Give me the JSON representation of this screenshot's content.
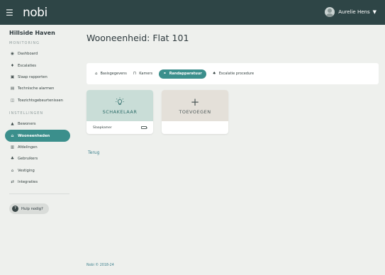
{
  "header": {
    "menu_icon": "hamburger-icon",
    "logo": "nobi",
    "user_name": "Aurelie Hens",
    "user_chevron": "chevron-down-icon"
  },
  "sidebar": {
    "org_name": "Hillside Haven",
    "monitoring_section": "MONITORING",
    "monitoring_items": [
      {
        "label": "Dashboard",
        "icon": "gauge-icon"
      },
      {
        "label": "Escalaties",
        "icon": "pin-icon"
      },
      {
        "label": "Slaap rapporten",
        "icon": "bed-icon"
      },
      {
        "label": "Technische alarmen",
        "icon": "server-icon"
      },
      {
        "label": "Toezichtsgebeurtenissen",
        "icon": "eye-icon"
      }
    ],
    "settings_section": "INSTELLINGEN",
    "settings_items": [
      {
        "label": "Bewoners",
        "icon": "people-icon"
      },
      {
        "label": "Wooneenheden",
        "icon": "house-icon",
        "active": true
      },
      {
        "label": "Afdelingen",
        "icon": "building-icon"
      },
      {
        "label": "Gebruikers",
        "icon": "users-icon"
      },
      {
        "label": "Vestiging",
        "icon": "home-icon"
      },
      {
        "label": "Integraties",
        "icon": "sync-icon"
      }
    ],
    "help_label": "Hulp nodig?"
  },
  "main": {
    "title": "Wooneenheid: Flat 101",
    "tabs": [
      {
        "label": "Basisgegevens",
        "icon": "house-icon"
      },
      {
        "label": "Kamers",
        "icon": "door-icon"
      },
      {
        "label": "Randapparatuur",
        "icon": "devices-icon",
        "active": true
      },
      {
        "label": "Escalatie procedure",
        "icon": "bell-icon"
      }
    ],
    "cards": [
      {
        "title": "SCHAKELAAR",
        "subtitle": "Slaapkamer",
        "icon": "lightbulb-icon"
      },
      {
        "title": "TOEVOEGEN",
        "subtitle": "",
        "icon": "plus-icon"
      }
    ],
    "back_link": "Terug",
    "footer": "Nobi © 2018-24"
  },
  "colors": {
    "topbar": "#2e4546",
    "accent": "#3b8f8c",
    "card_mint": "#c9ddd7",
    "card_beige": "#e4e0d9",
    "background": "#eef0ed"
  }
}
